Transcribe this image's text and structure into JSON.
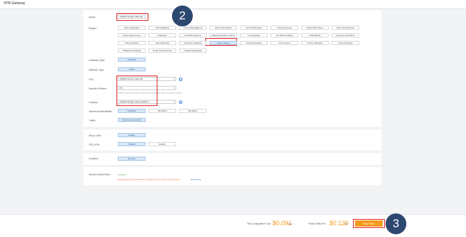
{
  "page_title": "VPN Gateway",
  "form": {
    "name_label": "Name",
    "name_value": "vfsaiw-bdd-vpn-aws-opt",
    "region_label": "Region",
    "regions": [
      [
        "China (Qingdao)",
        "China (Beijing)",
        "China (Zhangjiakou)",
        "China (Hangzhou)",
        "China (Shanghai)",
        "China (Heyuan)",
        "China (Shenzhen)",
        "China (Guangzhou)"
      ],
      [
        "China (Hong Kong)",
        "Singapore",
        "Australia (Sydney)",
        "Malaysia (Kuala Lumpur)",
        "US (Virginia)",
        "US (Silicon Valley)",
        "UAE (Dubai)",
        "Germany (Frankfurt)"
      ],
      [
        "China (Hohhot)",
        "India (Mumbai)",
        "Indonesia (Jakarta)",
        "Japan (Tokyo)",
        "China (Chengdu)",
        "UK (London)",
        "China (Ulanqab)",
        "China (Nanjing)"
      ],
      [
        "Philippines (Manila)",
        "South Korea (Seoul)",
        "Thailand (Bangkok)"
      ]
    ],
    "selected_region": "Japan (Tokyo)",
    "gateway_type_label": "Gateway Type",
    "gateway_type_value": "Standard",
    "network_type_label": "Network Type",
    "network_type_value": "Public",
    "vpc_label": "VPC",
    "vpc_value": "vfsaiw-bdd-vpn-aws-opt",
    "specify_vswitch_label": "Specify VSwitch",
    "specify_vswitch_value": "No",
    "specify_vswitch_hint": "Optional. Specify whether to create the VPN gateway under a specified VSwitch.",
    "vswitch_label": "VSwitch",
    "vswitch_value": "vfsaiw-bdd-vpn-aws-vswitch-a",
    "bandwidth_label": "Maximum Bandwidth",
    "bandwidth_options": [
      "10 Mbit/s",
      "100 Mbit/s",
      "200 Mbit/s"
    ],
    "traffic_label": "Traffic",
    "traffic_value": "Pay-by-data-transfer",
    "ipsec_label": "IPsec-VPN",
    "ipsec_value": "Enable",
    "ssl_label": "SSL-VPN",
    "ssl_options": [
      "Disable",
      "Enable"
    ],
    "duration_label": "Duration",
    "duration_value": "By Hour",
    "role_label": "Service-linked Role",
    "role_status": "Created",
    "role_note": "Requested service-linked role is required to access other cloud services",
    "role_link": "Role Details"
  },
  "footer": {
    "config_label": "Total Configuration Cost",
    "config_price": "$0.091",
    "config_unit": "/Hour",
    "traffic_label": "Public Traffic Fee",
    "traffic_price": "$0.120",
    "traffic_unit": "/GB",
    "buy_label": "Buy Now"
  },
  "annotations": {
    "badge_2": "2",
    "badge_3": "3"
  },
  "colors": {
    "accent": "#f39a1d",
    "highlight": "#e02020",
    "badge": "#2c4770",
    "selected": "#d7e7f7"
  }
}
